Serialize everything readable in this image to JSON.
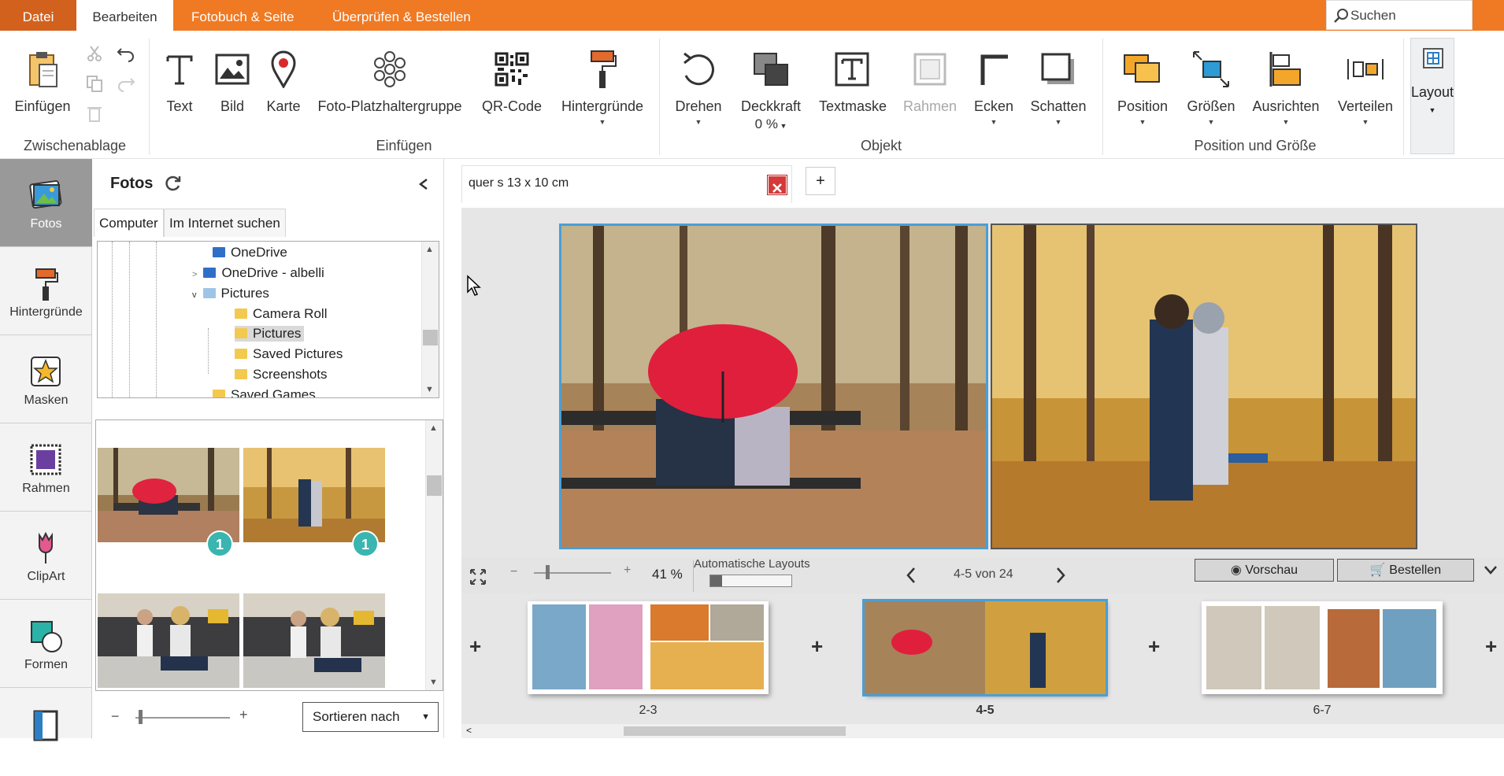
{
  "menu": {
    "file": "Datei",
    "tabs": [
      "Bearbeiten",
      "Fotobuch & Seite",
      "Überprüfen & Bestellen"
    ],
    "search_placeholder": "Suchen"
  },
  "ribbon": {
    "einfuegen": "Einfügen",
    "text": "Text",
    "bild": "Bild",
    "karte": "Karte",
    "foto_gruppe": "Foto-Platzhaltergruppe",
    "qr": "QR-Code",
    "hintergruende": "Hintergründe",
    "drehen": "Drehen",
    "deckkraft": "Deckkraft",
    "deckkraft_value": "0 %",
    "textmaske": "Textmaske",
    "rahmen": "Rahmen",
    "ecken": "Ecken",
    "schatten": "Schatten",
    "position": "Position",
    "groessen": "Größen",
    "ausrichten": "Ausrichten",
    "verteilen": "Verteilen",
    "layout": "Layout",
    "groups": {
      "zwischenablage": "Zwischenablage",
      "einfuegen": "Einfügen",
      "objekt": "Objekt",
      "position_groesse": "Position und Größe"
    }
  },
  "leftnav": [
    "Fotos",
    "Hintergründe",
    "Masken",
    "Rahmen",
    "ClipArt",
    "Formen"
  ],
  "panel": {
    "title": "Fotos",
    "tabs": [
      "Computer",
      "Im Internet suchen"
    ],
    "tree": [
      "OneDrive",
      "OneDrive - albelli",
      "Pictures",
      "Camera Roll",
      "Pictures",
      "Saved Pictures",
      "Screenshots",
      "Saved Games"
    ],
    "badges": [
      "1",
      "1"
    ],
    "sort_label": "Sortieren nach"
  },
  "canvas": {
    "doc_tab": "quer s 13 x 10 cm",
    "zoom": "41 %",
    "auto_layouts": "Automatische Layouts",
    "auto_layouts_progress": 0.15,
    "page_nav": "4-5 von 24",
    "preview": "Vorschau",
    "order": "Bestellen",
    "spreads": [
      "2-3",
      "4-5",
      "6-7"
    ]
  },
  "colors": {
    "accent": "#f07a23",
    "accent_dark": "#d2611d",
    "selection": "#4a9fd6",
    "badge": "#3ab5b0"
  }
}
